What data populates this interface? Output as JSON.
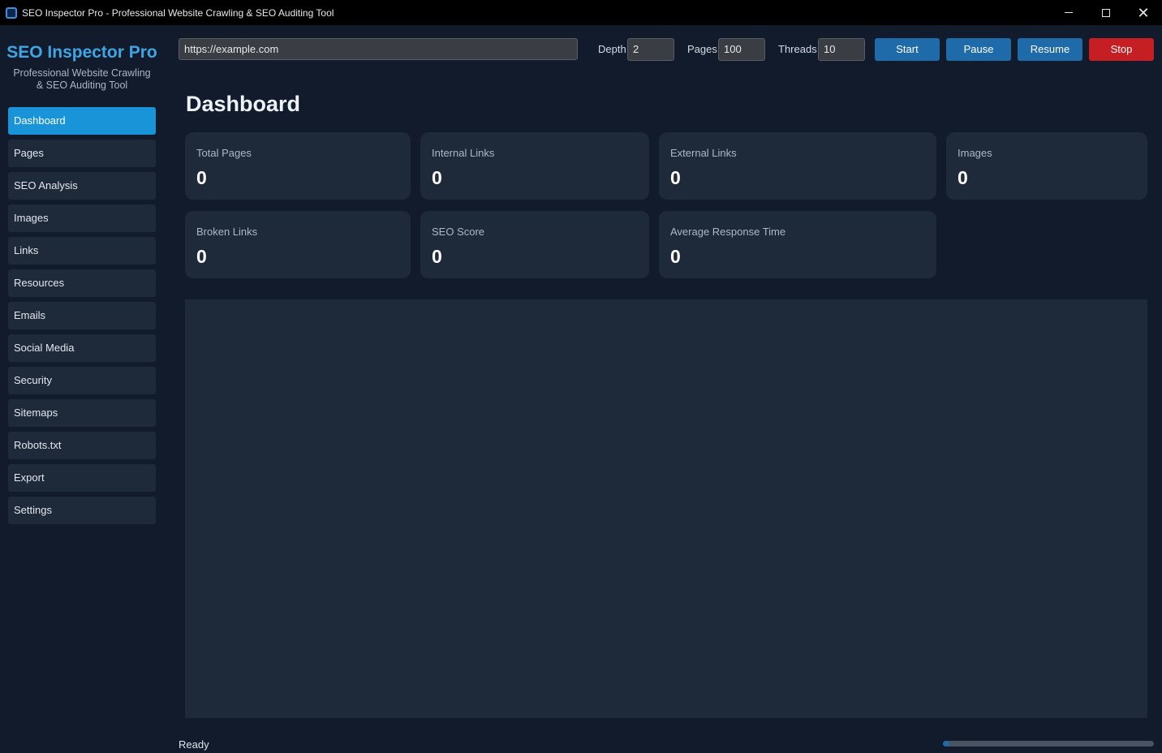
{
  "window": {
    "title": "SEO Inspector Pro - Professional Website Crawling & SEO Auditing Tool"
  },
  "sidebar": {
    "brand": "SEO Inspector Pro",
    "tagline_line1": "Professional Website Crawling",
    "tagline_line2": "& SEO Auditing Tool",
    "items": [
      {
        "label": "Dashboard",
        "active": true
      },
      {
        "label": "Pages"
      },
      {
        "label": "SEO Analysis"
      },
      {
        "label": "Images"
      },
      {
        "label": "Links"
      },
      {
        "label": "Resources"
      },
      {
        "label": "Emails"
      },
      {
        "label": "Social Media"
      },
      {
        "label": "Security"
      },
      {
        "label": "Sitemaps"
      },
      {
        "label": "Robots.txt"
      },
      {
        "label": "Export"
      },
      {
        "label": "Settings"
      }
    ]
  },
  "toolbar": {
    "url_value": "https://example.com",
    "depth_label": "Depth",
    "depth_value": "2",
    "pages_label": "Pages",
    "pages_value": "100",
    "threads_label": "Threads",
    "threads_value": "10",
    "start_label": "Start",
    "pause_label": "Pause",
    "resume_label": "Resume",
    "stop_label": "Stop"
  },
  "main": {
    "title": "Dashboard",
    "cards": [
      {
        "label": "Total Pages",
        "value": "0"
      },
      {
        "label": "Internal Links",
        "value": "0"
      },
      {
        "label": "External Links",
        "value": "0"
      },
      {
        "label": "Images",
        "value": "0"
      },
      {
        "label": "Broken Links",
        "value": "0"
      },
      {
        "label": "SEO Score",
        "value": "0"
      },
      {
        "label": "Average Response Time",
        "value": "0"
      }
    ]
  },
  "status": {
    "text": "Ready",
    "progress": 0.03
  },
  "colors": {
    "accent": "#1a94d8",
    "brand": "#3fa6e6",
    "button": "#1f6aa8",
    "stop": "#c51f24",
    "background": "#121b2c",
    "card": "#1e2939"
  }
}
